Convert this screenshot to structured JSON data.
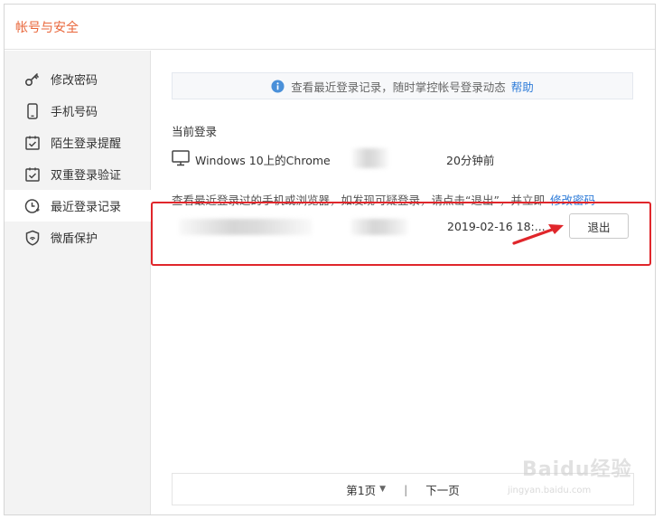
{
  "window": {
    "title": "帐号与安全"
  },
  "sidebar": {
    "items": [
      {
        "label": "修改密码",
        "icon": "key-icon"
      },
      {
        "label": "手机号码",
        "icon": "phone-icon"
      },
      {
        "label": "陌生登录提醒",
        "icon": "alert-calendar-icon"
      },
      {
        "label": "双重登录验证",
        "icon": "verify-calendar-icon"
      },
      {
        "label": "最近登录记录",
        "icon": "clock-icon",
        "active": true
      },
      {
        "label": "微盾保护",
        "icon": "shield-icon"
      }
    ]
  },
  "main": {
    "notice": {
      "text": "查看最近登录记录，随时掌控帐号登录动态",
      "help_label": "帮助"
    },
    "current_login": {
      "section_title": "当前登录",
      "device": "Windows 10上的Chrome",
      "time": "20分钟前"
    },
    "hint": {
      "text": "查看最近登录过的手机或浏览器，如发现可疑登录，请点击“退出”，并立即",
      "link": "修改密码"
    },
    "recent_login": {
      "time": "2019-02-16 18:...",
      "logout_label": "退出"
    },
    "pager": {
      "page_label": "第1页",
      "next_label": "下一页",
      "separator": "|"
    }
  },
  "watermark": {
    "brand": "Baidu经验",
    "url": "jingyan.baidu.com"
  },
  "colors": {
    "accent": "#e9663a",
    "link": "#2d7bd8",
    "highlight": "#e0262b"
  }
}
